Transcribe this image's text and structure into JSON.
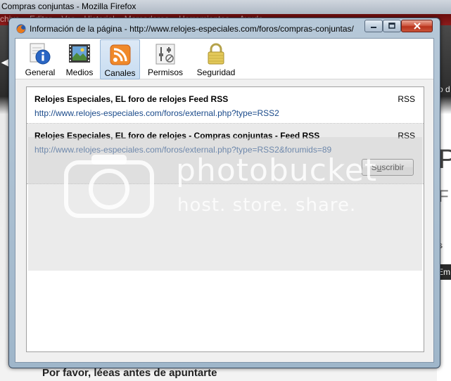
{
  "background_window": {
    "title": "Compras conjuntas - Mozilla Firefox",
    "menu": [
      "chivo",
      "Editar",
      "Ver",
      "Historial",
      "Marcadores",
      "Herramientas",
      "Ayuda"
    ],
    "right_fragments": [
      "o d",
      "P",
      "F",
      "s",
      "Em"
    ],
    "bottom_text": "Por favor, léeas antes de apuntarte"
  },
  "dialog": {
    "title": "Información de la página - http://www.relojes-especiales.com/foros/compras-conjuntas/",
    "tabs": [
      {
        "label": "General",
        "icon": "info-icon"
      },
      {
        "label": "Medios",
        "icon": "film-icon"
      },
      {
        "label": "Canales",
        "icon": "rss-icon",
        "active": true
      },
      {
        "label": "Permisos",
        "icon": "sliders-icon"
      },
      {
        "label": "Seguridad",
        "icon": "padlock-icon"
      }
    ],
    "feeds": [
      {
        "title": "Relojes Especiales, EL foro de relojes Feed RSS",
        "type": "RSS",
        "url": "http://www.relojes-especiales.com/foros/external.php?type=RSS2"
      },
      {
        "title": "Relojes Especiales, EL foro de relojes - Compras conjuntas - Feed RSS",
        "type": "RSS",
        "url": "http://www.relojes-especiales.com/foros/external.php?type=RSS2&forumids=89",
        "button_prefix": "S",
        "button_underlined": "u",
        "button_suffix": "scribir"
      }
    ]
  },
  "watermark": {
    "text": "photobucket",
    "subtext": "host. store. share."
  },
  "colors": {
    "link": "#1a4a8a",
    "active_tab": "#c7dcf1",
    "close_button": "#c9543a",
    "rss_orange": "#f0892a"
  }
}
